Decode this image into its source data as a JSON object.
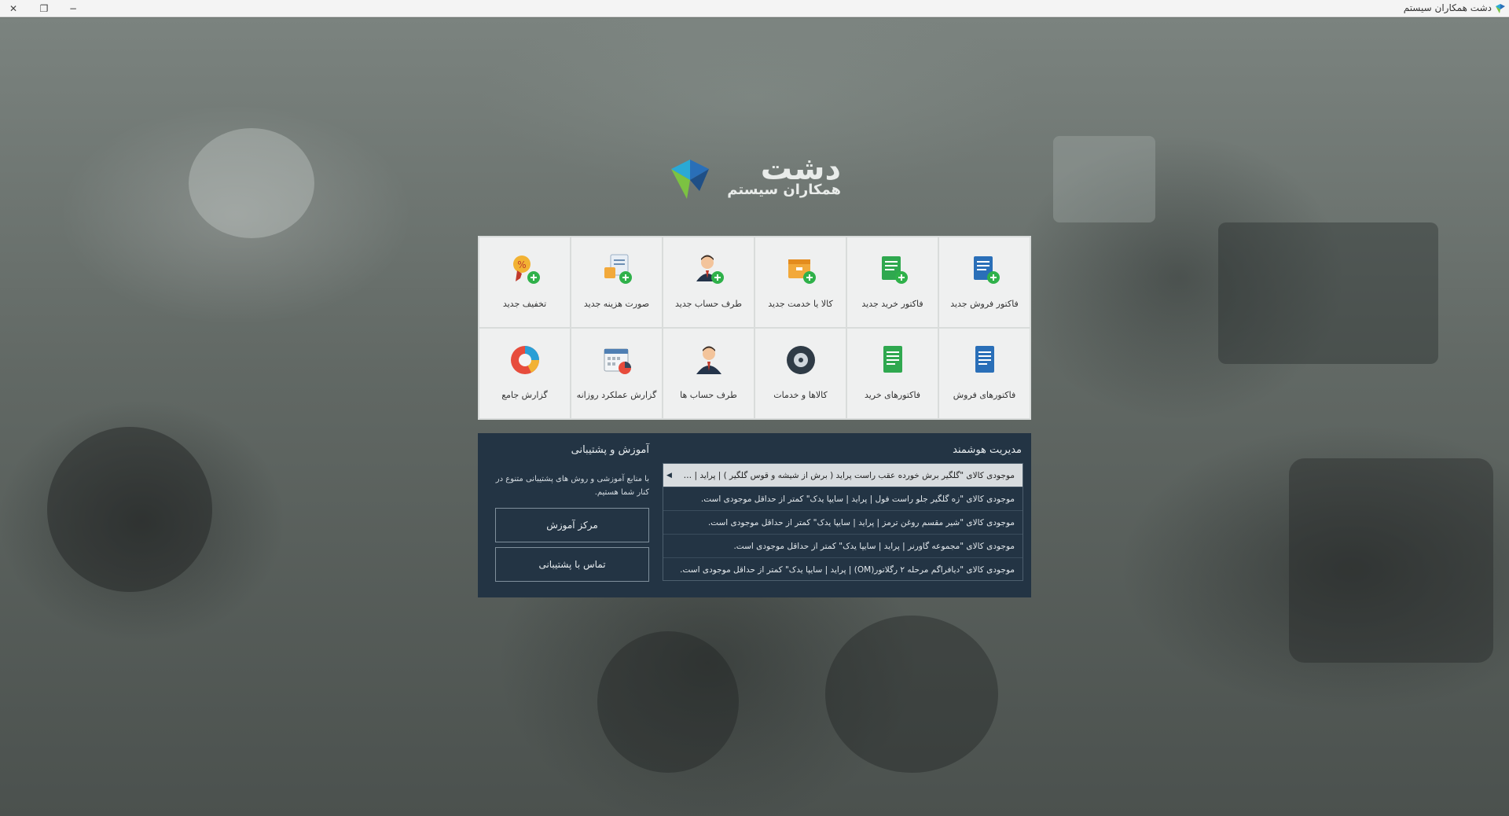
{
  "window": {
    "title": "دشت همکاران سیستم",
    "controls": {
      "close": "✕",
      "restore": "❐",
      "minimize": "−"
    }
  },
  "logo": {
    "main": "دشت",
    "sub": "همکاران سیستم"
  },
  "tiles": [
    {
      "label": "فاکتور فروش جدید",
      "icon": "sales-invoice-new-icon"
    },
    {
      "label": "فاکتور خرید جدید",
      "icon": "purchase-invoice-new-icon"
    },
    {
      "label": "کالا یا خدمت جدید",
      "icon": "product-new-icon"
    },
    {
      "label": "طرف حساب جدید",
      "icon": "account-party-new-icon"
    },
    {
      "label": "صورت هزینه جدید",
      "icon": "expense-new-icon"
    },
    {
      "label": "تخفیف جدید",
      "icon": "discount-new-icon"
    },
    {
      "label": "فاکتورهای فروش",
      "icon": "sales-invoices-icon"
    },
    {
      "label": "فاکتورهای خرید",
      "icon": "purchase-invoices-icon"
    },
    {
      "label": "کالاها و خدمات",
      "icon": "products-services-icon"
    },
    {
      "label": "طرف حساب ها",
      "icon": "account-parties-icon"
    },
    {
      "label": "گزارش عملکرد روزانه",
      "icon": "daily-report-icon"
    },
    {
      "label": "گزارش جامع",
      "icon": "comprehensive-report-icon"
    }
  ],
  "smart_management": {
    "title": "مدیریت هوشمند",
    "items": [
      "موجودی کالای  \"گلگیر برش خورده عقب راست پراید ( برش از شیشه و قوس گلگیر ) | پراید | سایپا ...",
      "موجودی کالای  \"زه گلگیر جلو راست فول | پراید | سایپا یدک\"  کمتر از حداقل موجودی است.",
      "موجودی کالای  \"شیر مقسم روغن ترمز | پراید | سایپا یدک\"  کمتر از حداقل موجودی است.",
      "موجودی کالای  \"مجموعه گاورنر | پراید | سایپا یدک\"  کمتر از حداقل موجودی است.",
      "موجودی کالای  \"دیافراگم مرحله ۲ رگلاتور(OM) | پراید | سایپا یدک\"  کمتر از حداقل موجودی است."
    ]
  },
  "support": {
    "title": "آموزش و  پشتیبانی",
    "description": "با منابع آموزشی و روش های پشتیبانی متنوع در کنار شما هستیم.",
    "training_button": "مرکز آموزش",
    "contact_button": "تماس با پشتیبانی"
  },
  "colors": {
    "panel": "#233444",
    "tile": "#eff0f0",
    "accent_green": "#2fb14a",
    "accent_blue": "#2a6fb8"
  }
}
